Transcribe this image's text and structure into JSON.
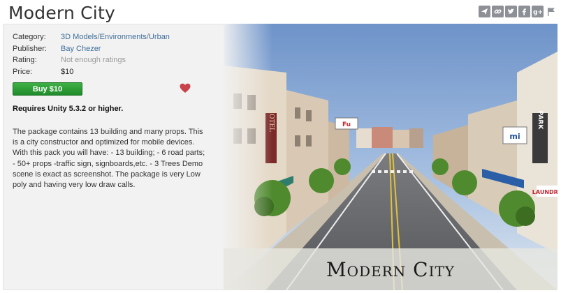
{
  "page": {
    "title": "Modern City"
  },
  "share": {
    "icons": [
      "share-icon",
      "link-icon",
      "twitter-icon",
      "facebook-icon",
      "google-plus-icon",
      "flag-icon"
    ]
  },
  "info": {
    "category_label": "Category:",
    "category_parts": [
      "3D Models",
      "Environments",
      "Urban"
    ],
    "category_sep": "/",
    "publisher_label": "Publisher:",
    "publisher": "Bay Chezer",
    "rating_label": "Rating:",
    "rating": "Not enough ratings",
    "price_label": "Price:",
    "price": "$10"
  },
  "buy": {
    "label": "Buy $10",
    "color": "#2a9a35"
  },
  "favorite": {
    "icon": "heart-icon",
    "color": "#c8414b"
  },
  "requirements": "Requires Unity 5.3.2 or higher.",
  "description": "The package contains 13 building and many props. This is a city constructor and optimized for mobile devices. With this pack you will have: - 13 building; - 6 road parts; - 50+ props -traffic sign, signboards,etc. - 3 Trees Demo scene is exact as screenshot. The package is very Low poly and having very low draw calls.",
  "hero": {
    "banner_title": "Modern City",
    "signs": {
      "hotel": "HOTEL",
      "park": "PARK",
      "laundry": "LAUNDRY",
      "mi": "mi",
      "fu": "Fu"
    }
  }
}
